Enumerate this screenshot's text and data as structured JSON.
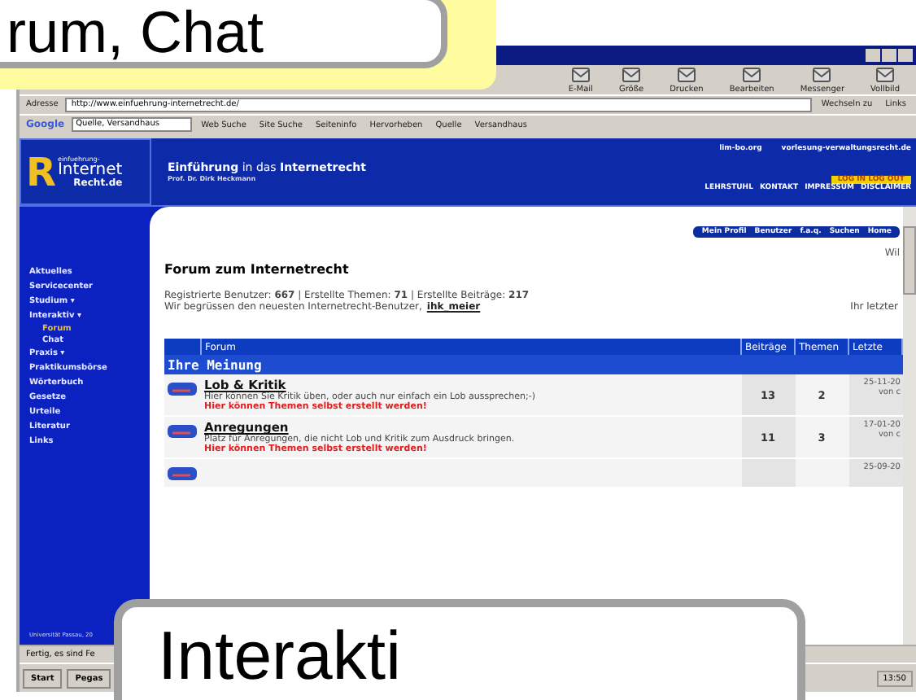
{
  "callouts": [
    {
      "kind": "top",
      "text": "rum, Chat"
    },
    {
      "kind": "bottom",
      "text": "Interakti"
    }
  ],
  "toolbar": [
    "E-Mail",
    "Größe",
    "Drucken",
    "Bearbeiten",
    "Messenger",
    "Vollbild"
  ],
  "address": {
    "label": "Adresse",
    "url": "http://www.einfuehrung-internetrecht.de/",
    "go": "Wechseln zu",
    "links": "Links"
  },
  "google_bar": {
    "brand": "Google",
    "query": "Quelle, Versandhaus",
    "items": [
      "Web Suche",
      "Site Suche",
      "Seiteninfo",
      "Hervorheben",
      "Quelle",
      "Versandhaus"
    ]
  },
  "site": {
    "logo": [
      "R",
      "einfuehrung-",
      "Internet",
      "Recht.de"
    ],
    "title": "**Einführung** in das **Internetrecht**",
    "subtitle": "Prof. Dr. Dirk Heckmann",
    "top_links": [
      "lim-bo.org",
      "vorlesung-verwaltungsrecht.de"
    ],
    "login": "LOG IN  LOG OUT",
    "nav": [
      "LEHRSTUHL",
      "KONTAKT",
      "IMPRESSUM",
      "DISCLAIMER"
    ]
  },
  "sidebar": {
    "items": [
      {
        "label": "Aktuelles",
        "selected": false
      },
      {
        "label": "Servicecenter",
        "selected": false
      },
      {
        "label": "Studium ▾",
        "selected": false
      },
      {
        "label": "Interaktiv ▾",
        "selected": false,
        "children": [
          {
            "label": "Forum",
            "selected": true
          },
          {
            "label": "Chat",
            "selected": false
          }
        ]
      },
      {
        "label": "Praxis ▾",
        "selected": false
      },
      {
        "label": "Praktikumsbörse",
        "selected": false
      },
      {
        "label": "Wörterbuch",
        "selected": false
      },
      {
        "label": "Gesetze",
        "selected": false
      },
      {
        "label": "Urteile",
        "selected": false
      },
      {
        "label": "Literatur",
        "selected": false
      },
      {
        "label": "Links",
        "selected": false
      }
    ],
    "footer": "Universität Passau, 20"
  },
  "forum": {
    "buttons": [
      "Mein Profil",
      "Benutzer",
      "f.a.q.",
      "Suchen",
      "Home"
    ],
    "welcome": "Wil",
    "heading": "Forum zum Internetrecht",
    "stats": "Registrierte Benutzer: **667** | Erstellte Themen: **71** | Erstellte Beiträge: **217**",
    "greeting": "Wir begrüssen den neuesten Internetrecht-Benutzer,",
    "newest_user": "ihk_meier",
    "last_visit": "Ihr letzter",
    "columns": [
      "Forum",
      "Beiträge",
      "Themen",
      "Letzte"
    ],
    "category": "Ihre Meinung",
    "rows": [
      {
        "title": "Lob & Kritik",
        "description": "Hier können Sie Kritik üben, oder auch nur einfach ein Lob aussprechen;-)",
        "notice": "Hier können Themen selbst erstellt werden!",
        "posts": "13",
        "topics": "2",
        "last_date": "25-11-20",
        "last_by": "von c"
      },
      {
        "title": "Anregungen",
        "description": "Platz für Anregungen, die nicht Lob und Kritik zum Ausdruck bringen.",
        "notice": "Hier können Themen selbst erstellt werden!",
        "posts": "11",
        "topics": "3",
        "last_date": "17-01-20",
        "last_by": "von c"
      },
      {
        "last_date": "25-09-20"
      }
    ]
  },
  "status_bar": "Fertig, es sind Fe",
  "taskbar": {
    "start": "Start",
    "tasks": [
      "Pegas"
    ],
    "clock": "13:50"
  }
}
